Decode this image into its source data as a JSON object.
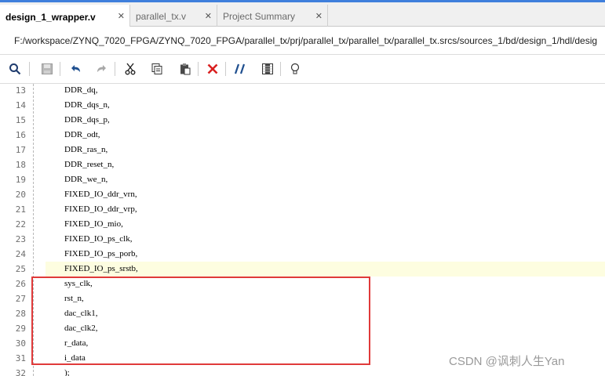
{
  "tabs": [
    {
      "label": "design_1_wrapper.v",
      "close": "✕",
      "active": true
    },
    {
      "label": "parallel_tx.v",
      "close": "✕",
      "active": false
    },
    {
      "label": "Project Summary",
      "close": "✕",
      "active": false
    }
  ],
  "path": "F:/workspace/ZYNQ_7020_FPGA/ZYNQ_7020_FPGA/parallel_tx/prj/parallel_tx/parallel_tx/parallel_tx.srcs/sources_1/bd/design_1/hdl/desig",
  "toolbar": {
    "icons": [
      "search-icon",
      "save-icon",
      "undo-icon",
      "redo-icon",
      "cut-icon",
      "copy-icon",
      "paste-icon",
      "delete-icon",
      "comment-icon",
      "column-icon",
      "lightbulb-icon"
    ]
  },
  "lines": [
    {
      "num": "13",
      "code": "DDR_dq,"
    },
    {
      "num": "14",
      "code": "DDR_dqs_n,"
    },
    {
      "num": "15",
      "code": "DDR_dqs_p,"
    },
    {
      "num": "16",
      "code": "DDR_odt,"
    },
    {
      "num": "17",
      "code": "DDR_ras_n,"
    },
    {
      "num": "18",
      "code": "DDR_reset_n,"
    },
    {
      "num": "19",
      "code": "DDR_we_n,"
    },
    {
      "num": "20",
      "code": "FIXED_IO_ddr_vrn,"
    },
    {
      "num": "21",
      "code": "FIXED_IO_ddr_vrp,"
    },
    {
      "num": "22",
      "code": "FIXED_IO_mio,"
    },
    {
      "num": "23",
      "code": "FIXED_IO_ps_clk,"
    },
    {
      "num": "24",
      "code": "FIXED_IO_ps_porb,"
    },
    {
      "num": "25",
      "code": "FIXED_IO_ps_srstb,"
    },
    {
      "num": "26",
      "code": "sys_clk,"
    },
    {
      "num": "27",
      "code": "rst_n,"
    },
    {
      "num": "28",
      "code": "dac_clk1,"
    },
    {
      "num": "29",
      "code": "dac_clk2,"
    },
    {
      "num": "30",
      "code": "r_data,"
    },
    {
      "num": "31",
      "code": "i_data"
    },
    {
      "num": "32",
      "code": ");"
    }
  ],
  "highlighted_line": "25",
  "watermark": "CSDN @讽刺人生Yan",
  "colors": {
    "accent": "#3f7fdc",
    "annotation": "#e03a3a",
    "delete": "#d92020",
    "highlight": "#fdfde0"
  }
}
